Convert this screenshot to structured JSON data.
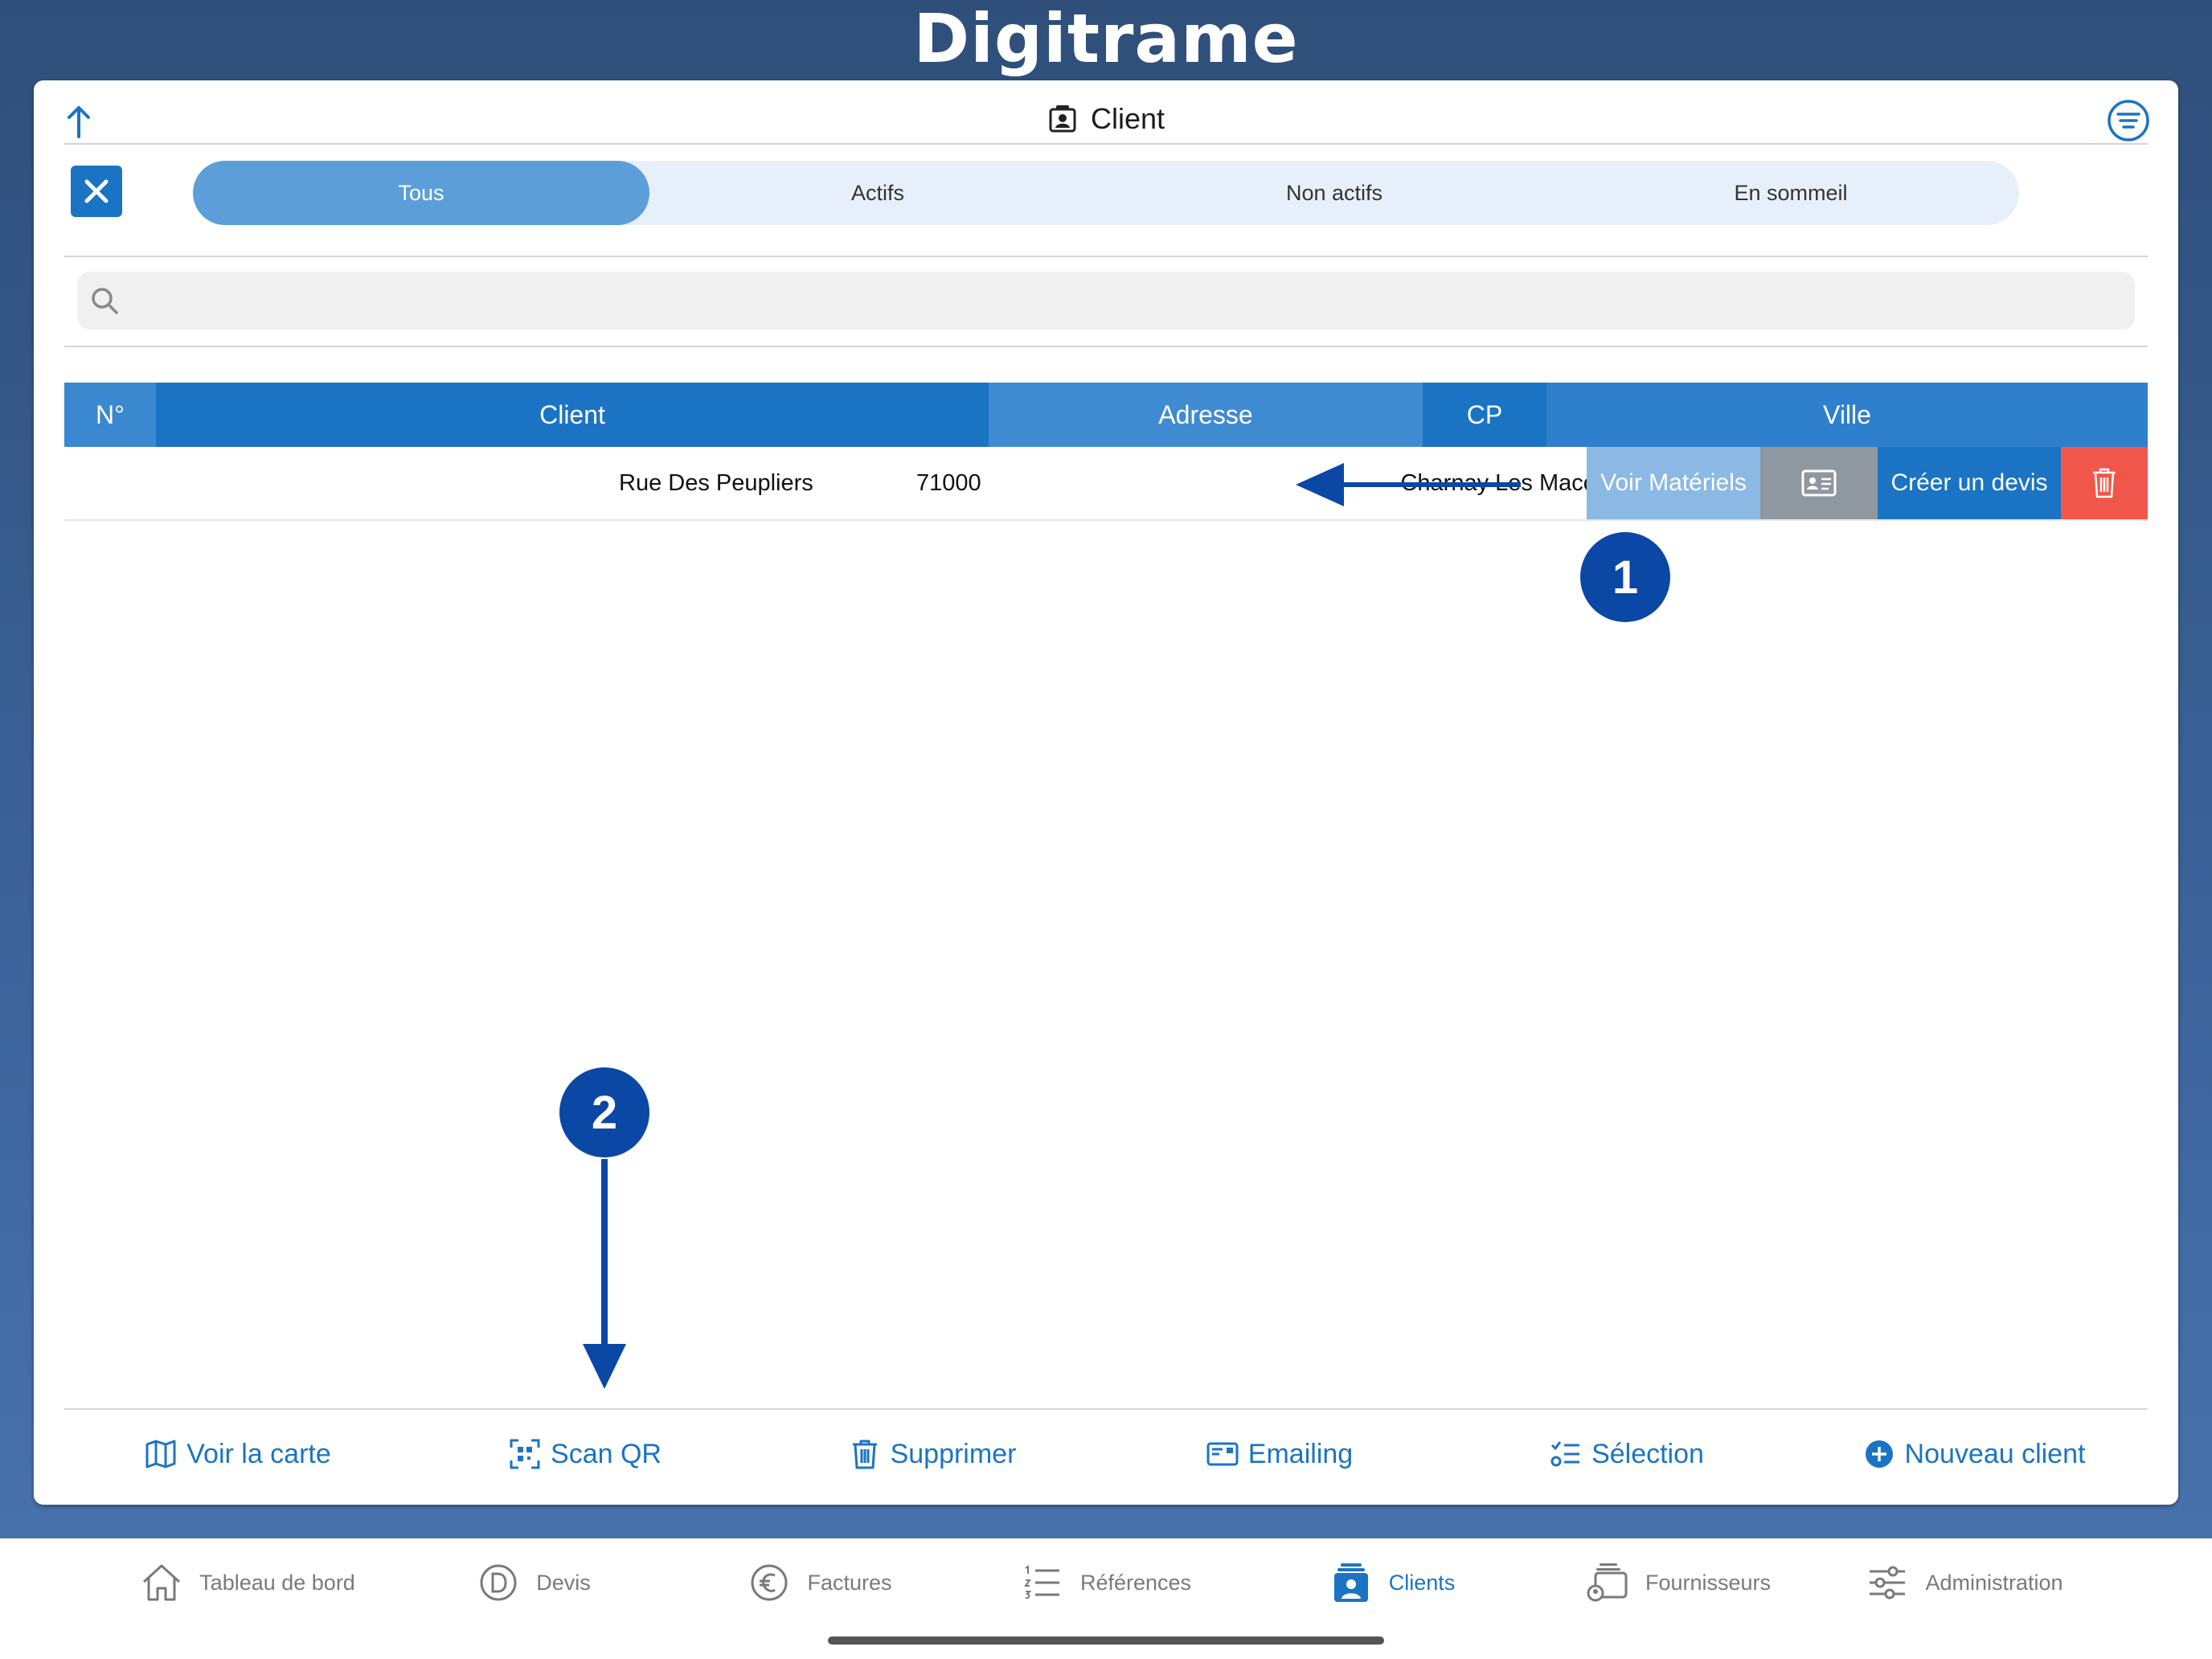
{
  "brand": "Digitrame",
  "header": {
    "title": "Client"
  },
  "filters": {
    "segments": [
      "Tous",
      "Actifs",
      "Non actifs",
      "En sommeil"
    ],
    "active": "Tous"
  },
  "search": {
    "placeholder": ""
  },
  "table": {
    "columns": [
      "N°",
      "Client",
      "Adresse",
      "CP",
      "Ville"
    ],
    "rows": [
      {
        "numero": "",
        "client": "",
        "adresse": "Rue Des Peupliers",
        "cp": "71000",
        "ville": "Charnay Les Macon"
      }
    ],
    "row_actions": {
      "voir_materiels": "Voir Matériels",
      "fiche_icon": "contact-card-icon",
      "creer_devis": "Créer un devis",
      "delete_icon": "trash-icon"
    }
  },
  "annotations": {
    "badge1": "1",
    "badge2": "2"
  },
  "toolbar": {
    "voir_carte": "Voir la carte",
    "scan_qr": "Scan QR",
    "supprimer": "Supprimer",
    "emailing": "Emailing",
    "selection": "Sélection",
    "nouveau_client": "Nouveau client"
  },
  "tabbar": {
    "items": [
      {
        "label": "Tableau de bord",
        "icon": "home-icon"
      },
      {
        "label": "Devis",
        "icon": "devis-icon"
      },
      {
        "label": "Factures",
        "icon": "euro-icon"
      },
      {
        "label": "Références",
        "icon": "list-icon"
      },
      {
        "label": "Clients",
        "icon": "clients-icon"
      },
      {
        "label": "Fournisseurs",
        "icon": "suppliers-icon"
      },
      {
        "label": "Administration",
        "icon": "sliders-icon"
      }
    ],
    "active": "Clients"
  },
  "colors": {
    "primary": "#1b74c3",
    "segment_active": "#5c9fd8",
    "delete": "#f0574a",
    "voir_materiels": "#8cb8e4",
    "fiche": "#8f97a1",
    "annotation": "#0b47a5"
  }
}
